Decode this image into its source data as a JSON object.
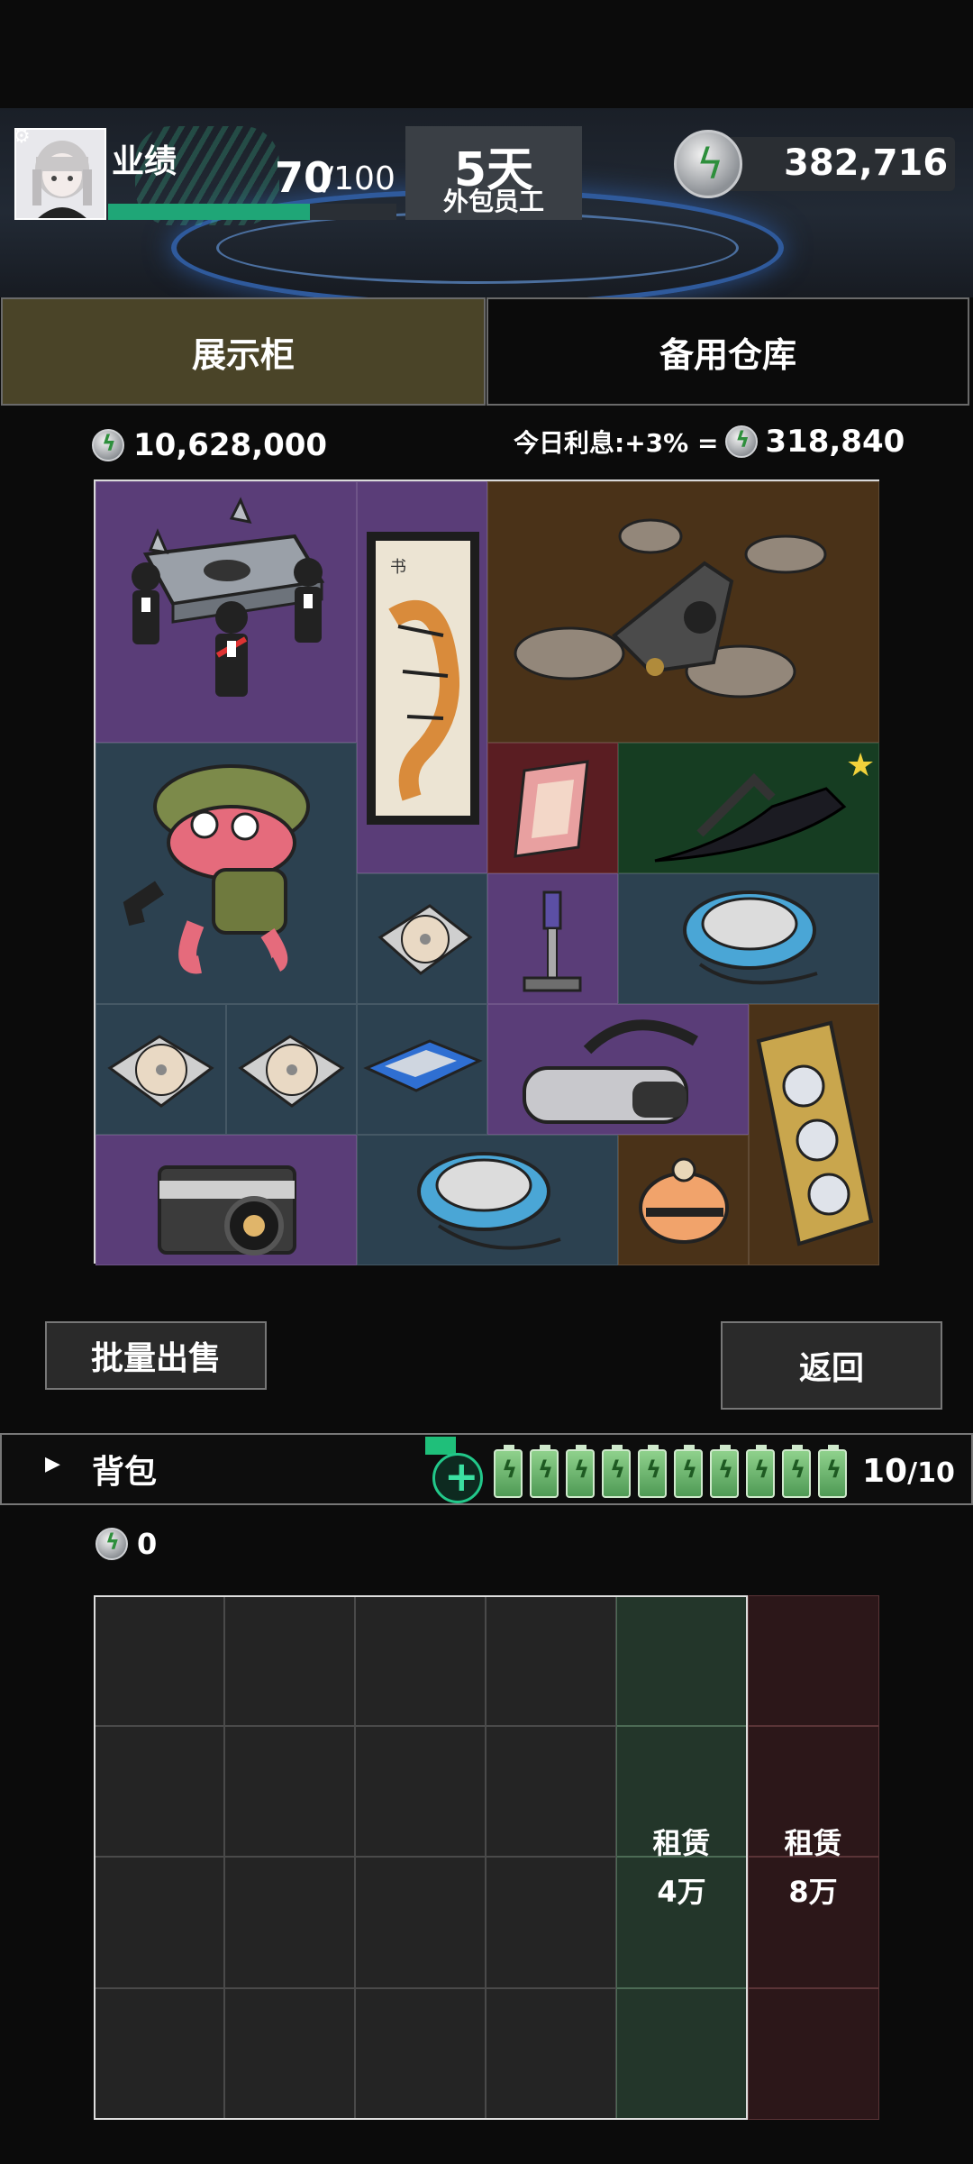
{
  "hud": {
    "performance_label": "业绩",
    "performance_value": "70",
    "performance_max": "/100",
    "performance_progress": 0.7,
    "days_value": "5天",
    "rank_label": "外包员工",
    "coins_total": "382,716"
  },
  "tabs": {
    "showcase": "展示柜",
    "warehouse": "备用仓库"
  },
  "showcase": {
    "total_value": "10,628,000",
    "interest_label": "今日利息:+3% =",
    "interest_value": "318,840",
    "items": [
      {
        "name": "coffin-dance-speaker",
        "icon": "coffin-dance-icon"
      },
      {
        "name": "tiger-scroll",
        "icon": "tiger-scroll-icon"
      },
      {
        "name": "drone",
        "icon": "drone-icon"
      },
      {
        "name": "frog-plush",
        "icon": "frog-icon"
      },
      {
        "name": "crystal-card",
        "icon": "crystal-card-icon"
      },
      {
        "name": "sword-sculpture",
        "icon": "sword-sculpture-icon"
      },
      {
        "name": "cd-disc",
        "icon": "cd-icon"
      },
      {
        "name": "figure-keychain",
        "icon": "figure-icon"
      },
      {
        "name": "cd-player",
        "icon": "cd-player-icon"
      },
      {
        "name": "vr-headset",
        "icon": "vr-headset-icon"
      },
      {
        "name": "gpu-card",
        "icon": "gpu-icon"
      },
      {
        "name": "ssd-drive",
        "icon": "ssd-icon"
      },
      {
        "name": "film-camera",
        "icon": "camera-icon"
      },
      {
        "name": "helmet",
        "icon": "helmet-icon"
      }
    ]
  },
  "buttons": {
    "sell": "批量出售",
    "back": "返回"
  },
  "bag": {
    "label": "背包",
    "count": "10",
    "max": "/10",
    "coins": "0",
    "rent1_label": "租赁",
    "rent1_price": "4万",
    "rent2_label": "租赁",
    "rent2_price": "8万"
  },
  "colors": {
    "purple": "#5a3d78",
    "brown": "#4a3218",
    "teal": "#2c4150",
    "accent": "#1fa677"
  }
}
